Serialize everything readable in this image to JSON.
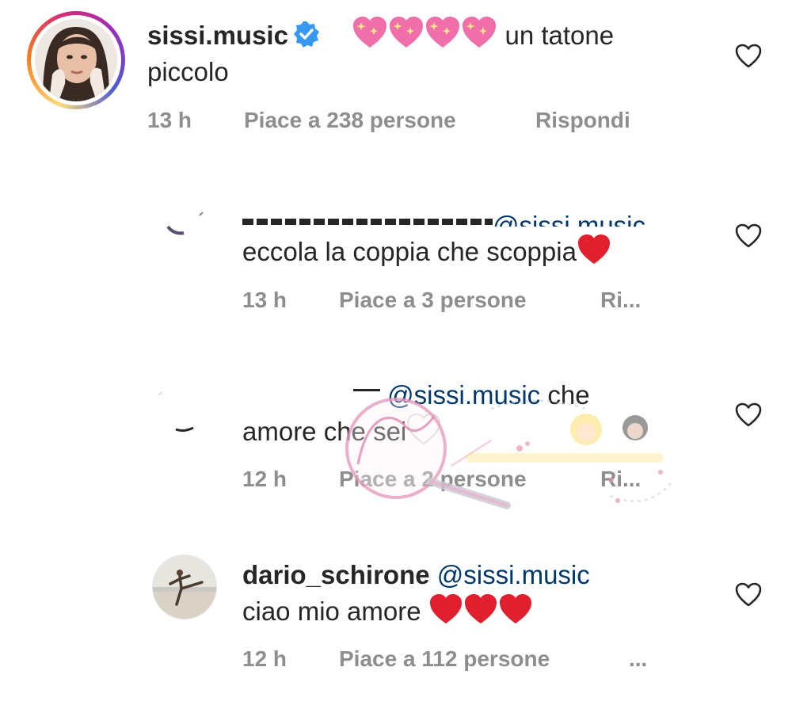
{
  "comments": [
    {
      "username": "sissi.music",
      "verified": true,
      "text_line1": "un tatone",
      "text_line2": "piccolo",
      "emoji": "sparkling-heart",
      "emoji_count": 4,
      "time": "13 h",
      "likes": "Piace a 238 persone",
      "reply": "Rispondi",
      "liked": false
    },
    {
      "username_partial": "",
      "mention": "@sissi.music",
      "text_line2": "eccola la coppia che scoppia",
      "emoji": "red-heart",
      "time": "13 h",
      "likes": "Piace a 3 persone",
      "reply": "Ri...",
      "liked": false
    },
    {
      "mention": "@sissi.music",
      "text_line1_tail": "che",
      "text_line2": "amore che sei",
      "emoji": "white-heart",
      "time": "12 h",
      "likes": "Piace a 2 persone",
      "reply": "Ri...",
      "liked": false
    },
    {
      "username": "dario_schirone",
      "mention": "@sissi.music",
      "text_line2": "ciao mio amore",
      "emoji": "red-heart",
      "emoji_count": 3,
      "time": "12 h",
      "likes": "Piace a 112 persone",
      "more": "...",
      "liked": false
    }
  ],
  "colors": {
    "text": "#262626",
    "meta": "#8e8e8e",
    "mention": "#00376b",
    "verified": "#3897f0",
    "heart_red": "#e0202f"
  },
  "icons": [
    "verified-badge-icon",
    "sparkling-heart-emoji",
    "red-heart-emoji",
    "white-heart-emoji",
    "like-heart-icon"
  ]
}
